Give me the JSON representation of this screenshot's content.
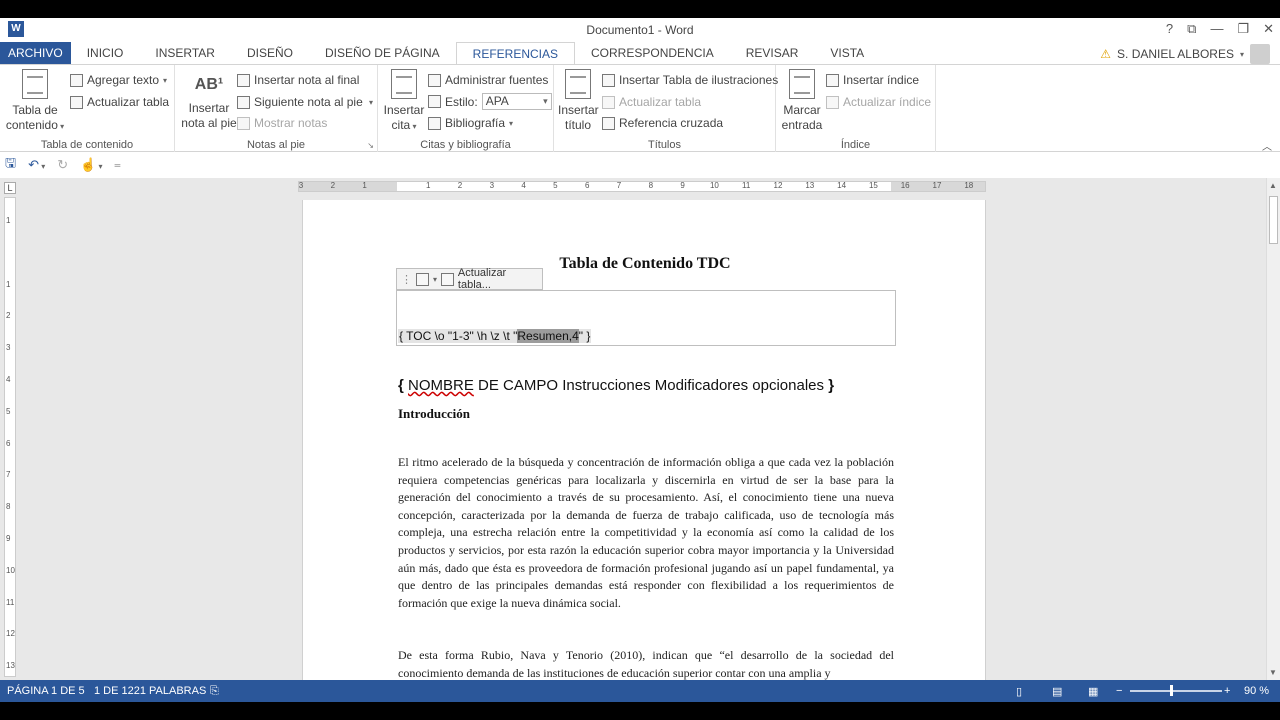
{
  "window": {
    "title": "Documento1 - Word",
    "app_icon": "W",
    "controls": [
      "?",
      "⧉",
      "—",
      "❐",
      "✕"
    ]
  },
  "tabs": [
    "ARCHIVO",
    "INICIO",
    "INSERTAR",
    "DISEÑO",
    "DISEÑO DE PÁGINA",
    "REFERENCIAS",
    "CORRESPONDENCIA",
    "REVISAR",
    "VISTA"
  ],
  "active_tab": "REFERENCIAS",
  "user": {
    "name": "S. DANIEL ALBORES",
    "warning_icon": "⚠"
  },
  "ribbon": {
    "toc": {
      "label": "Tabla de contenido",
      "big_button_line1": "Tabla de",
      "big_button_line2": "contenido",
      "add_text": "Agregar texto",
      "update_table": "Actualizar tabla"
    },
    "footnotes": {
      "label": "Notas al pie",
      "ab_icon": "AB¹",
      "insert_footnote_line1": "Insertar",
      "insert_footnote_line2": "nota al pie",
      "insert_endnote": "Insertar nota al final",
      "next_footnote": "Siguiente nota al pie",
      "show_notes": "Mostrar notas"
    },
    "citations": {
      "label": "Citas y bibliografía",
      "insert_citation_line1": "Insertar",
      "insert_citation_line2": "cita",
      "manage_sources": "Administrar fuentes",
      "style_label": "Estilo:",
      "style_value": "APA",
      "bibliography": "Bibliografía"
    },
    "captions": {
      "label": "Títulos",
      "insert_caption_line1": "Insertar",
      "insert_caption_line2": "título",
      "insert_table_of_figures": "Insertar Tabla de ilustraciones",
      "update_table": "Actualizar tabla",
      "cross_reference": "Referencia cruzada"
    },
    "index": {
      "label": "Índice",
      "mark_entry_line1": "Marcar",
      "mark_entry_line2": "entrada",
      "insert_index": "Insertar índice",
      "update_index": "Actualizar índice"
    }
  },
  "ruler": {
    "h_numbers": [
      "3",
      "2",
      "1",
      "",
      "1",
      "2",
      "3",
      "4",
      "5",
      "6",
      "7",
      "8",
      "9",
      "10",
      "11",
      "12",
      "13",
      "14",
      "15",
      "16",
      "17",
      "18"
    ],
    "v_numbers": [
      "1",
      "",
      "1",
      "2",
      "3",
      "4",
      "5",
      "6",
      "7",
      "8",
      "9",
      "10",
      "11",
      "12",
      "13"
    ]
  },
  "document": {
    "title": "Tabla de Contenido TDC",
    "field_update_button": "Actualizar tabla...",
    "toc_code_prefix": "{ TOC \\o \"1-3\" \\h \\z \\t \"",
    "toc_code_highlight": "Resumen,4",
    "toc_code_suffix": "\" }",
    "instruction_open": "{ ",
    "instruction_word1": "NOMBRE",
    "instruction_rest": " DE CAMPO Instrucciones Modificadores opcionales ",
    "instruction_close": "}",
    "intro_heading": "Introducción",
    "paragraph1": "El ritmo acelerado de la búsqueda y concentración de información obliga a que cada vez la población requiera competencias genéricas para localizarla y discernirla en virtud de ser la base para la generación del conocimiento a través de su procesamiento. Así, el conocimiento tiene una nueva concepción, caracterizada por la demanda de fuerza de trabajo calificada, uso de tecnología más compleja, una estrecha relación entre la competitividad y la economía así como la calidad de los productos y servicios, por esta razón la educación superior cobra mayor importancia y la Universidad aún más, dado que ésta es proveedora de formación profesional jugando así un papel fundamental, ya que dentro de las principales demandas está responder con flexibilidad a los requerimientos de formación que exige la nueva dinámica social.",
    "paragraph2": "De esta forma Rubio, Nava y Tenorio (2010), indican que “el desarrollo de la sociedad del conocimiento demanda de las instituciones de educación superior contar con una amplia y"
  },
  "status": {
    "page": "PÁGINA 1 DE 5",
    "words": "1 DE 1221 PALABRAS",
    "zoom": "90 %",
    "zoom_level_percent": 90
  }
}
